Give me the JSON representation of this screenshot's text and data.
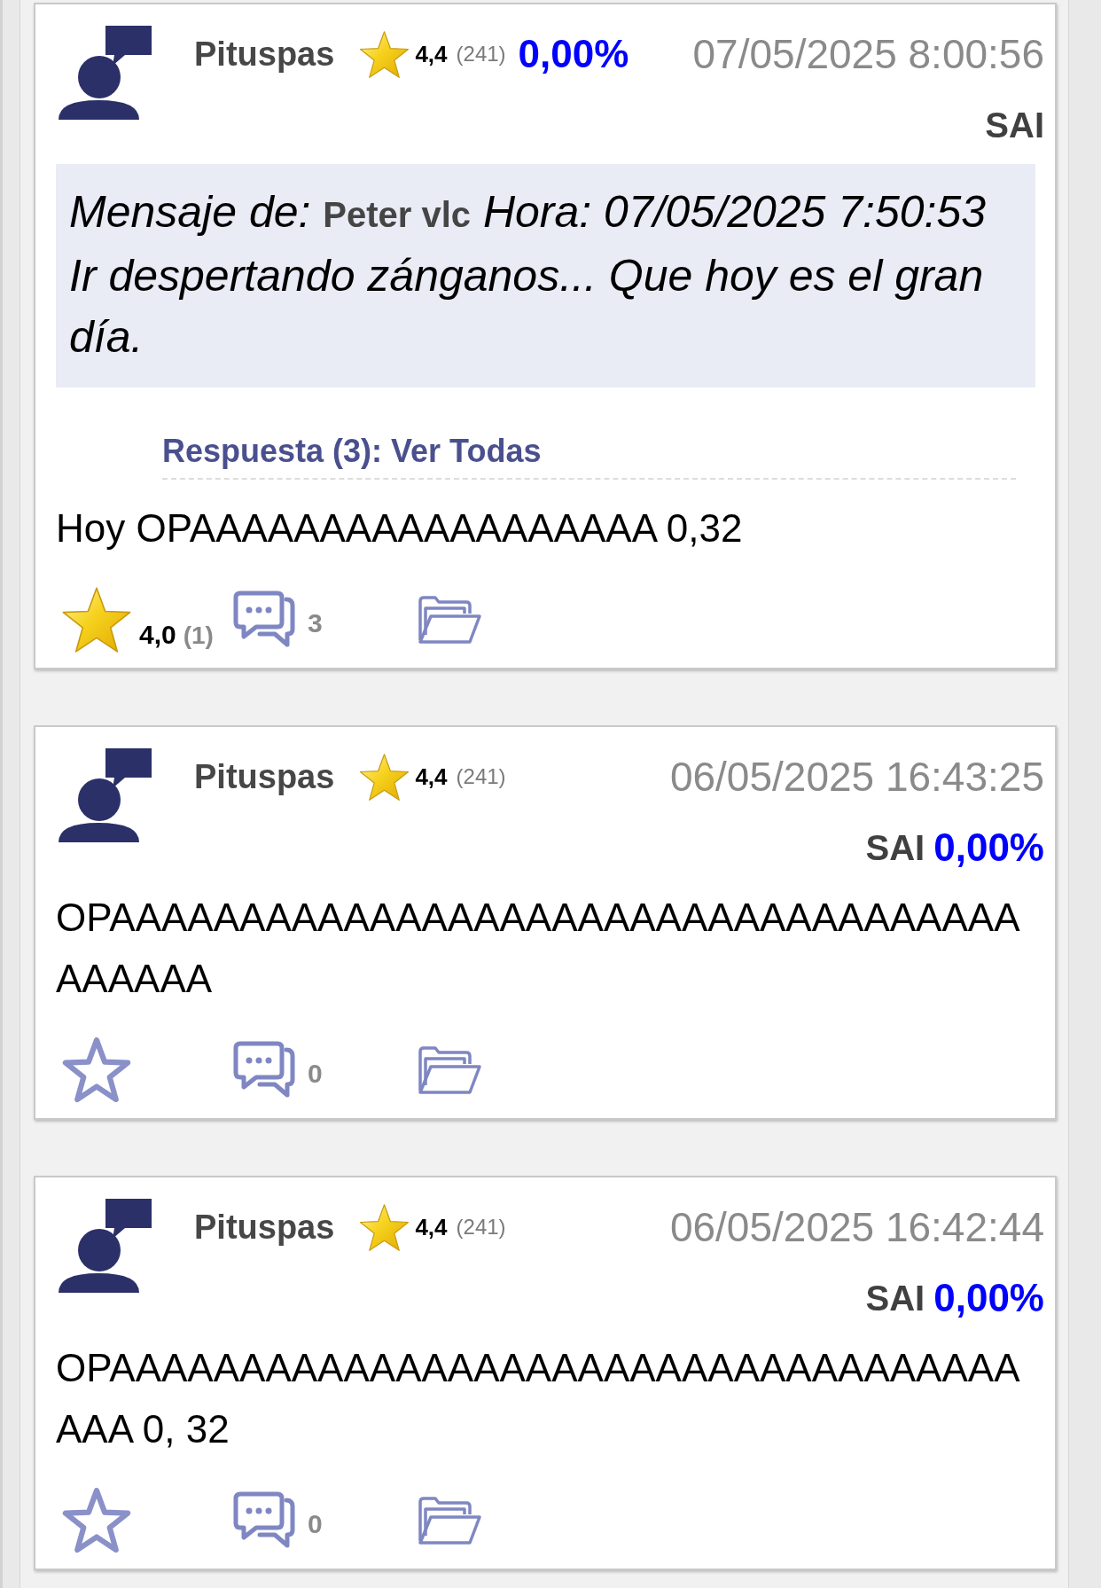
{
  "posts": [
    {
      "author": "Pituspas",
      "author_rating": "4,4",
      "author_votes": "(241)",
      "change": {
        "text": "0,00%",
        "in_header": true
      },
      "datetime": "07/05/2025 8:00:56",
      "ticker": "SAI",
      "quote": {
        "header": "Mensaje de: **Peter vlc** Hora: 07/05/2025 7:50:53",
        "text": "Ir despertando zánganos... Que hoy es el gran día."
      },
      "replies_link": "Respuesta (3): Ver Todas",
      "text": "Hoy OPAAAAAAAAAAAAAAAAAA 0,32",
      "footer": {
        "rated": true,
        "rating": "4,0",
        "votes": "(1)",
        "comment_count": "3"
      }
    },
    {
      "author": "Pituspas",
      "author_rating": "4,4",
      "author_votes": "(241)",
      "change": {
        "text": "0,00%",
        "in_header": false
      },
      "datetime": "06/05/2025 16:43:25",
      "ticker": "SAI",
      "text": "OPAAAAAAAAAAAAAAAAAAAAAAAAAAAAAAAAAAAAAAAAA",
      "footer": {
        "rated": false,
        "comment_count": "0"
      }
    },
    {
      "author": "Pituspas",
      "author_rating": "4,4",
      "author_votes": "(241)",
      "change": {
        "text": "0,00%",
        "in_header": false
      },
      "datetime": "06/05/2025 16:42:44",
      "ticker": "SAI",
      "text": "OPAAAAAAAAAAAAAAAAAAAAAAAAAAAAAAAAAAAAAA 0, 32",
      "footer": {
        "rated": false,
        "comment_count": "0"
      }
    }
  ]
}
